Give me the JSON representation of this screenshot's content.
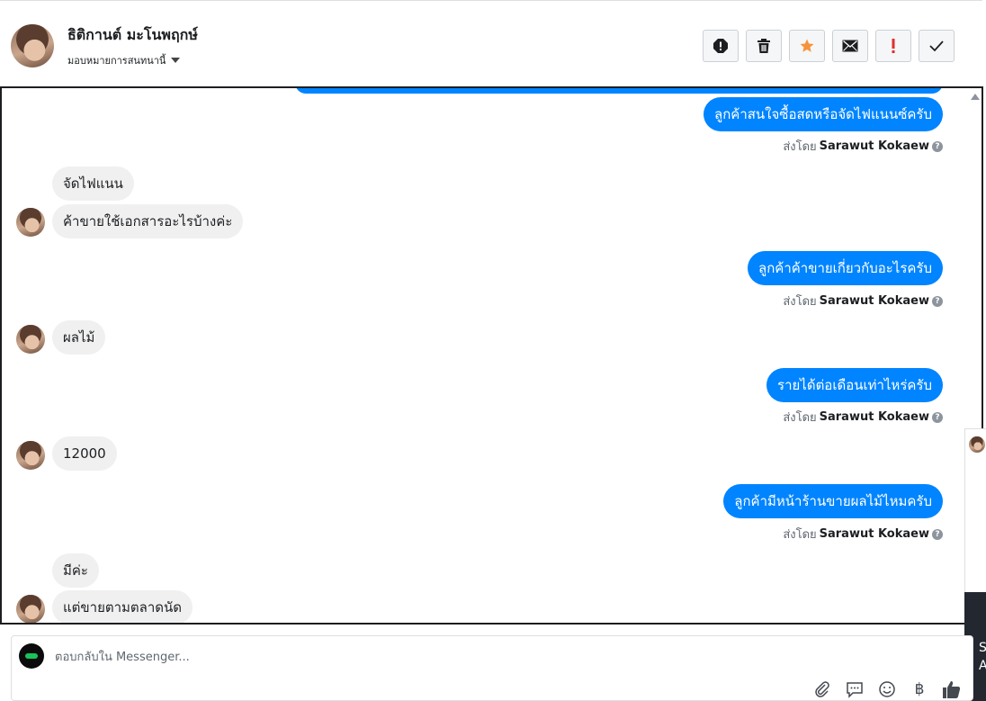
{
  "header": {
    "contact_name": "ธิติกานต์ มะโนพฤกษ์",
    "assign_label": "มอบหมายการสนทนานี้",
    "actions": [
      {
        "name": "report-spam-icon"
      },
      {
        "name": "trash-icon"
      },
      {
        "name": "star-icon",
        "color": "#f7923a"
      },
      {
        "name": "envelope-icon"
      },
      {
        "name": "follow-up-icon",
        "color": "#e02f2f"
      },
      {
        "name": "checkmark-icon"
      }
    ]
  },
  "conversation": {
    "sender_prefix": "ส่งโดย",
    "sender_name": "Sarawut Kokaew",
    "messages": [
      {
        "dir": "out",
        "text": "ลูกค้าสนใจซื้อสดหรือจัดไฟแนนซ์ครับ"
      },
      {
        "dir": "in",
        "text": "จัดไฟแนน"
      },
      {
        "dir": "in",
        "text": "ค้าขายใช้เอกสารอะไรบ้างค่ะ"
      },
      {
        "dir": "out",
        "text": "ลูกค้าค้าขายเกี่ยวกับอะไรครับ"
      },
      {
        "dir": "in",
        "text": "ผลไม้"
      },
      {
        "dir": "out",
        "text": "รายได้ต่อเดือนเท่าไหร่ครับ"
      },
      {
        "dir": "in",
        "text": "12000"
      },
      {
        "dir": "out",
        "text": "ลูกค้ามีหน้าร้านขายผลไม้ไหมครับ"
      },
      {
        "dir": "in",
        "text": "มีค่ะ"
      },
      {
        "dir": "in",
        "text": "แต่ขายตามตลาดนัด"
      }
    ]
  },
  "side_panel": {
    "lines": [
      "S",
      "A"
    ]
  },
  "composer": {
    "placeholder": "ตอบกลับใน Messenger...",
    "value": "",
    "currency_symbol": "฿",
    "tools": [
      "paperclip-icon",
      "saved-reply-icon",
      "emoji-icon",
      "payment-icon",
      "thumbs-up-icon"
    ]
  },
  "colors": {
    "outgoing_bubble": "#0084ff",
    "incoming_bubble": "#f0f0f0",
    "star": "#f7923a",
    "follow_up": "#e02f2f"
  }
}
